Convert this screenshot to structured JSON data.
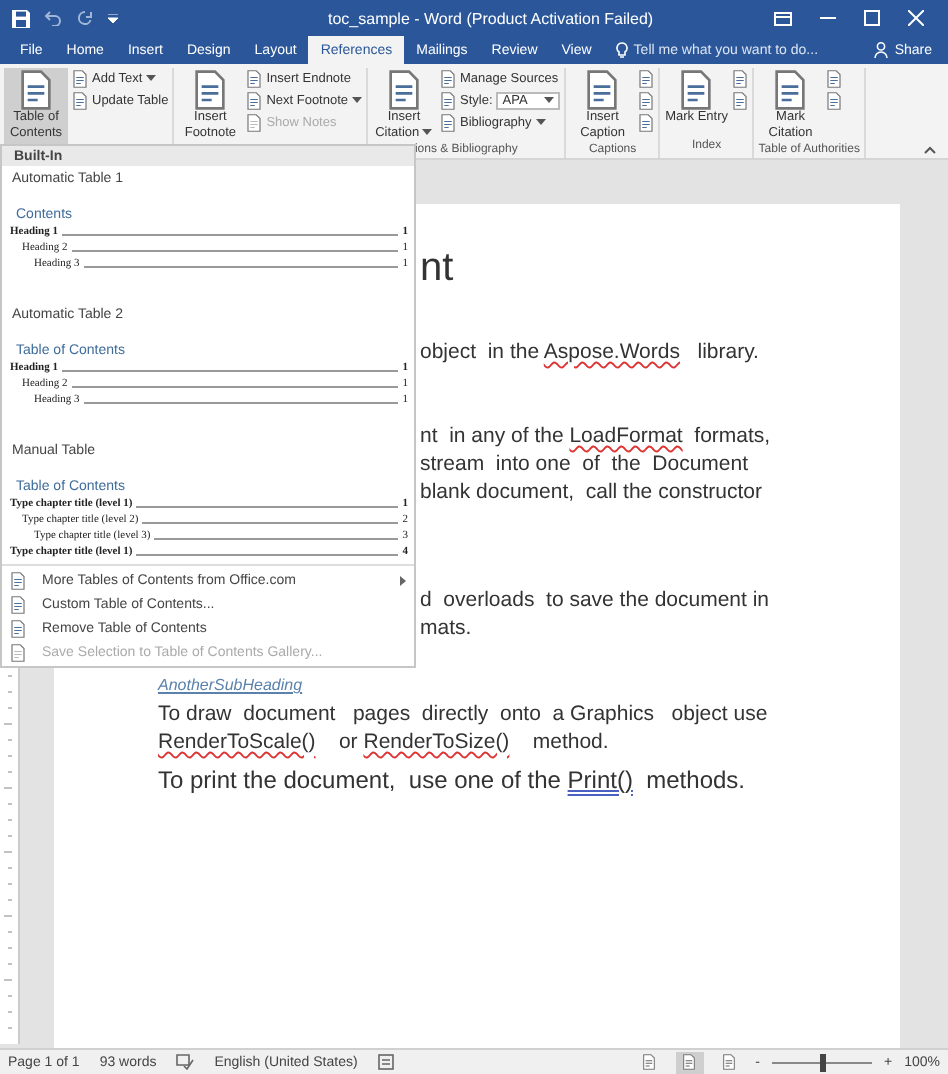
{
  "title_bar": {
    "title": "toc_sample - Word (Product Activation Failed)"
  },
  "tabs": [
    {
      "label": "File",
      "selected": false
    },
    {
      "label": "Home",
      "selected": false
    },
    {
      "label": "Insert",
      "selected": false
    },
    {
      "label": "Design",
      "selected": false
    },
    {
      "label": "Layout",
      "selected": false
    },
    {
      "label": "References",
      "selected": true
    },
    {
      "label": "Mailings",
      "selected": false
    },
    {
      "label": "Review",
      "selected": false
    },
    {
      "label": "View",
      "selected": false
    }
  ],
  "tell_me": {
    "placeholder": "Tell me what you want to do..."
  },
  "share": "Share",
  "ribbon": {
    "groups": [
      {
        "columns": [
          {
            "kind": "large",
            "label": "Table of Contents",
            "dropdown": true,
            "pressed": true
          },
          {
            "kind": "stack",
            "items": [
              {
                "kind": "small",
                "label": "Add Text",
                "dropdown": true,
                "disabled": false
              },
              {
                "kind": "small",
                "label": "Update Table",
                "dropdown": false,
                "disabled": false
              }
            ]
          }
        ]
      },
      {
        "columns": [
          {
            "kind": "large",
            "label": "Insert Footnote",
            "dropdown": false,
            "pressed": false
          },
          {
            "kind": "stack",
            "items": [
              {
                "kind": "small",
                "label": "Insert Endnote",
                "dropdown": false,
                "disabled": false
              },
              {
                "kind": "small",
                "label": "Next Footnote",
                "dropdown": true,
                "disabled": false
              },
              {
                "kind": "small",
                "label": "Show Notes",
                "dropdown": false,
                "disabled": true
              }
            ]
          }
        ]
      },
      {
        "label": "ions & Bibliography",
        "columns": [
          {
            "kind": "large",
            "label": "Insert Citation",
            "dropdown": true,
            "pressed": false
          },
          {
            "kind": "stack",
            "items": [
              {
                "kind": "small",
                "label": "Manage Sources",
                "dropdown": false,
                "disabled": false
              },
              {
                "kind": "select",
                "label": "Style:",
                "value": "APA"
              },
              {
                "kind": "small",
                "label": "Bibliography",
                "dropdown": true,
                "disabled": false
              }
            ]
          }
        ]
      },
      {
        "label": "Captions",
        "columns": [
          {
            "kind": "large",
            "label": "Insert Caption",
            "dropdown": false,
            "pressed": false
          },
          {
            "kind": "stack",
            "items": [
              {
                "kind": "icon"
              },
              {
                "kind": "icon"
              },
              {
                "kind": "icon"
              }
            ]
          }
        ]
      },
      {
        "label": "Index",
        "columns": [
          {
            "kind": "large",
            "label": "Mark Entry",
            "dropdown": false,
            "pressed": false
          },
          {
            "kind": "stack",
            "items": [
              {
                "kind": "icon"
              },
              {
                "kind": "icon"
              }
            ]
          }
        ]
      },
      {
        "label": "Table of Authorities",
        "columns": [
          {
            "kind": "large",
            "label": "Mark Citation",
            "dropdown": false,
            "pressed": false
          },
          {
            "kind": "stack",
            "items": [
              {
                "kind": "icon"
              },
              {
                "kind": "icon"
              }
            ]
          }
        ]
      }
    ]
  },
  "document": {
    "paragraphs": [
      {
        "kind": "heading",
        "covered": true,
        "lines": [
          [
            {
              "text": "nt",
              "kind": "plain"
            }
          ]
        ]
      },
      {
        "kind": "text",
        "covered": true,
        "lines": [
          [
            {
              "text": "object  in the ",
              "kind": "plain"
            },
            {
              "text": "Aspose.Words",
              "kind": "spelling"
            },
            {
              "text": "   library.",
              "kind": "plain"
            }
          ]
        ]
      },
      {
        "kind": "text",
        "covered": true,
        "lines": [
          [
            {
              "text": "nt  in any of the ",
              "kind": "plain"
            },
            {
              "text": "LoadFormat",
              "kind": "spelling"
            },
            {
              "text": "  formats,",
              "kind": "plain"
            }
          ],
          [
            {
              "text": "stream  into one  of  the  Document",
              "kind": "plain"
            }
          ],
          [
            {
              "text": "blank document,  call the constructor",
              "kind": "plain"
            }
          ]
        ]
      },
      {
        "kind": "text",
        "covered": true,
        "lines": [
          [
            {
              "text": "d  overloads  to save the document in",
              "kind": "plain"
            }
          ],
          [
            {
              "text": "mats.",
              "kind": "plain"
            }
          ]
        ]
      },
      {
        "kind": "subheading",
        "lines": [
          [
            {
              "text": "AnotherSubHeading",
              "kind": "plain"
            }
          ]
        ]
      },
      {
        "kind": "text",
        "lines": [
          [
            {
              "text": "To draw  document   pages  directly  onto  a Graphics   object use",
              "kind": "plain"
            }
          ],
          [
            {
              "text": "RenderToScale()",
              "kind": "spelling"
            },
            {
              "text": "    or ",
              "kind": "plain"
            },
            {
              "text": "RenderToSize()",
              "kind": "spelling"
            },
            {
              "text": "    method.",
              "kind": "plain"
            }
          ]
        ]
      },
      {
        "kind": "large",
        "lines": [
          [
            {
              "text": "To print the document,  use one of the ",
              "kind": "plain"
            },
            {
              "text": "Print()",
              "kind": "grammar"
            },
            {
              "text": "  methods.",
              "kind": "plain"
            }
          ]
        ]
      }
    ]
  },
  "toc_menu": {
    "header": "Built-In",
    "gallery": [
      {
        "title": "Automatic Table 1",
        "preview_title": "Contents",
        "entries": [
          {
            "text": "Heading 1",
            "page": "1",
            "children": [
              {
                "text": "Heading 2",
                "page": "1",
                "children": [
                  {
                    "text": "Heading 3",
                    "page": "1"
                  }
                ]
              }
            ]
          }
        ]
      },
      {
        "title": "Automatic Table 2",
        "preview_title": "Table of Contents",
        "entries": [
          {
            "text": "Heading 1",
            "page": "1",
            "children": [
              {
                "text": "Heading 2",
                "page": "1",
                "children": [
                  {
                    "text": "Heading 3",
                    "page": "1"
                  }
                ]
              }
            ]
          }
        ]
      },
      {
        "title": "Manual Table",
        "preview_title": "Table of Contents",
        "entries": [
          {
            "text": "Type chapter title (level 1)",
            "page": "1",
            "children": [
              {
                "text": "Type chapter title (level 2)",
                "page": "2",
                "children": [
                  {
                    "text": "Type chapter title (level 3)",
                    "page": "3"
                  }
                ]
              }
            ]
          },
          {
            "text": "Type chapter title (level 1)",
            "page": "4"
          }
        ]
      }
    ],
    "commands": [
      {
        "label": "More Tables of Contents from Office.com",
        "submenu": true,
        "disabled": false
      },
      {
        "label": "Custom Table of Contents...",
        "submenu": false,
        "disabled": false
      },
      {
        "label": "Remove Table of Contents",
        "submenu": false,
        "disabled": false
      },
      {
        "label": "Save Selection to Table of Contents Gallery...",
        "submenu": false,
        "disabled": true
      }
    ]
  },
  "status_bar": {
    "page": "Page 1 of 1",
    "words": "93 words",
    "language": "English (United States)",
    "views": [
      {
        "selected": false
      },
      {
        "selected": true
      },
      {
        "selected": false
      }
    ],
    "zoom_out": "-",
    "zoom_in": "+",
    "zoom": {
      "level": 0.5
    },
    "zoom_label": "100%"
  }
}
